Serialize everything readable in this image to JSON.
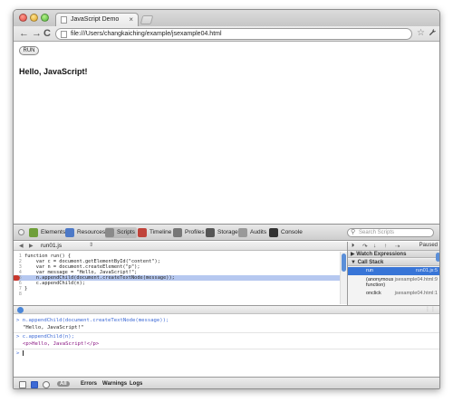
{
  "browser": {
    "tab_title": "JavaScript Demo",
    "tab_close": "×",
    "url": "file:///Users/changkaiching/example/jsexample04.html",
    "nav": {
      "back": "←",
      "forward": "→",
      "reload": "C"
    },
    "star": "☆",
    "wrench": "🔧"
  },
  "page": {
    "run_button": "RUN",
    "heading": "Hello, JavaScript!"
  },
  "devtools": {
    "panels": [
      {
        "label": "Elements",
        "icon": "elements-icon",
        "color": "#6f9f3a"
      },
      {
        "label": "Resources",
        "icon": "resources-icon",
        "color": "#4d79c7"
      },
      {
        "label": "Scripts",
        "icon": "scripts-icon",
        "color": "#8a8a8a"
      },
      {
        "label": "Timeline",
        "icon": "timeline-icon",
        "color": "#c0433a"
      },
      {
        "label": "Profiles",
        "icon": "profiles-icon",
        "color": "#777777"
      },
      {
        "label": "Storage",
        "icon": "storage-icon",
        "color": "#555555"
      },
      {
        "label": "Audits",
        "icon": "audits-icon",
        "color": "#999999"
      },
      {
        "label": "Console",
        "icon": "console-icon",
        "color": "#333333"
      }
    ],
    "search_placeholder": "Search Scripts",
    "script_file": "run01.js",
    "code": [
      {
        "n": "1",
        "text": "function run() {"
      },
      {
        "n": "2",
        "text": "    var c = document.getElementById(\"content\");"
      },
      {
        "n": "3",
        "text": "    var n = document.createElement(\"p\");"
      },
      {
        "n": "4",
        "text": "    var message = \"Hello, JavaScript!\";"
      },
      {
        "n": "5",
        "text": "    n.appendChild(document.createTextNode(message));"
      },
      {
        "n": "6",
        "text": "    c.appendChild(n);"
      },
      {
        "n": "7",
        "text": "}"
      },
      {
        "n": "8",
        "text": ""
      }
    ],
    "status": "Paused",
    "sections": {
      "watch": "▶ Watch Expressions",
      "call_stack": "▼ Call Stack"
    },
    "call_stack": [
      {
        "fn": "run",
        "loc": "run01.js:5"
      },
      {
        "fn": "(anonymous function)",
        "loc": "jsexample04.html:9"
      },
      {
        "fn": "onclick",
        "loc": "jsexample04.html:1"
      }
    ],
    "console": [
      {
        "type": "cmd",
        "text": "n.appendChild(document.createTextNode(message));"
      },
      {
        "type": "res",
        "text": "\"Hello, JavaScript!\""
      },
      {
        "type": "cmd",
        "text": "c.appendChild(n);"
      },
      {
        "type": "res",
        "text": "<p>Hello, JavaScript!</p>"
      }
    ],
    "prompt": ">",
    "filters": {
      "all": "All",
      "errors": "Errors",
      "warnings": "Warnings",
      "logs": "Logs"
    }
  }
}
